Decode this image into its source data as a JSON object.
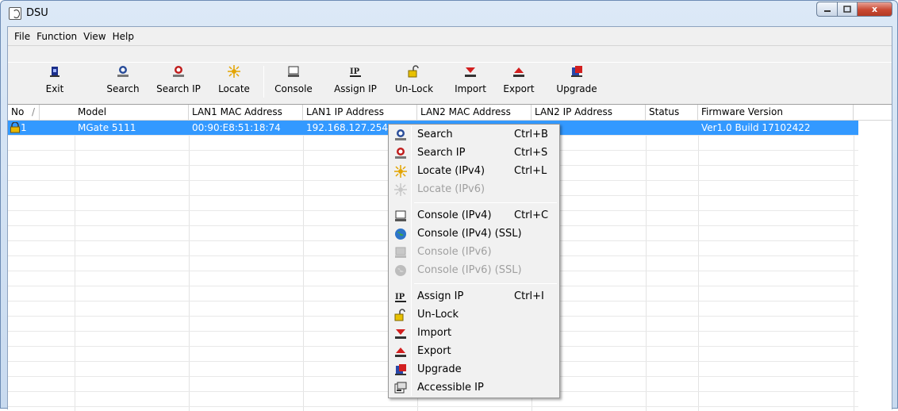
{
  "window": {
    "title": "DSU",
    "min_icon": "minimize-icon",
    "max_icon": "maximize-icon",
    "close_icon": "close-icon",
    "close_glyph": "x"
  },
  "menubar": {
    "items": [
      "File",
      "Function",
      "View",
      "Help"
    ]
  },
  "toolbar": {
    "buttons": [
      {
        "label": "Exit",
        "icon": "exit-icon"
      },
      {
        "label": "Search",
        "icon": "search-icon"
      },
      {
        "label": "Search IP",
        "icon": "search-ip-icon"
      },
      {
        "label": "Locate",
        "icon": "locate-icon"
      },
      {
        "label": "Console",
        "icon": "console-icon"
      },
      {
        "label": "Assign IP",
        "icon": "assign-ip-icon"
      },
      {
        "label": "Un-Lock",
        "icon": "unlock-icon"
      },
      {
        "label": "Import",
        "icon": "import-icon"
      },
      {
        "label": "Export",
        "icon": "export-icon"
      },
      {
        "label": "Upgrade",
        "icon": "upgrade-icon"
      }
    ]
  },
  "grid": {
    "columns": [
      "No",
      "/",
      "Model",
      "LAN1 MAC Address",
      "LAN1 IP Address",
      "LAN2 MAC Address",
      "LAN2 IP Address",
      "Status",
      "Firmware Version"
    ],
    "rows": [
      {
        "no": "1",
        "model": "MGate 5111",
        "lan1_mac": "00:90:E8:51:18:74",
        "lan1_ip": "192.168.127.254",
        "lan2_mac": "",
        "lan2_ip": "",
        "status": "",
        "firmware": "Ver1.0 Build 17102422",
        "locked": true
      }
    ]
  },
  "context_menu": {
    "items": [
      {
        "label": "Search",
        "shortcut": "Ctrl+B",
        "icon": "search-icon",
        "enabled": true
      },
      {
        "label": "Search IP",
        "shortcut": "Ctrl+S",
        "icon": "search-ip-icon",
        "enabled": true
      },
      {
        "label": "Locate (IPv4)",
        "shortcut": "Ctrl+L",
        "icon": "locate-icon",
        "enabled": true
      },
      {
        "label": "Locate (IPv6)",
        "shortcut": "",
        "icon": "locate-icon",
        "enabled": false
      },
      {
        "label": "Console (IPv4)",
        "shortcut": "Ctrl+C",
        "icon": "console-icon",
        "enabled": true
      },
      {
        "label": "Console (IPv4) (SSL)",
        "shortcut": "",
        "icon": "globe-icon",
        "enabled": true
      },
      {
        "label": "Console (IPv6)",
        "shortcut": "",
        "icon": "console-icon",
        "enabled": false
      },
      {
        "label": "Console (IPv6) (SSL)",
        "shortcut": "",
        "icon": "globe-icon",
        "enabled": false
      },
      {
        "label": "Assign IP",
        "shortcut": "Ctrl+I",
        "icon": "assign-ip-icon",
        "enabled": true
      },
      {
        "label": "Un-Lock",
        "shortcut": "",
        "icon": "unlock-icon",
        "enabled": true
      },
      {
        "label": "Import",
        "shortcut": "",
        "icon": "import-icon",
        "enabled": true
      },
      {
        "label": "Export",
        "shortcut": "",
        "icon": "export-icon",
        "enabled": true
      },
      {
        "label": "Upgrade",
        "shortcut": "",
        "icon": "upgrade-icon",
        "enabled": true
      },
      {
        "label": "Accessible IP",
        "shortcut": "",
        "icon": "accessible-ip-icon",
        "enabled": true
      }
    ]
  },
  "colors": {
    "selection": "#3399ff",
    "lock_icon": "#e8b800"
  }
}
